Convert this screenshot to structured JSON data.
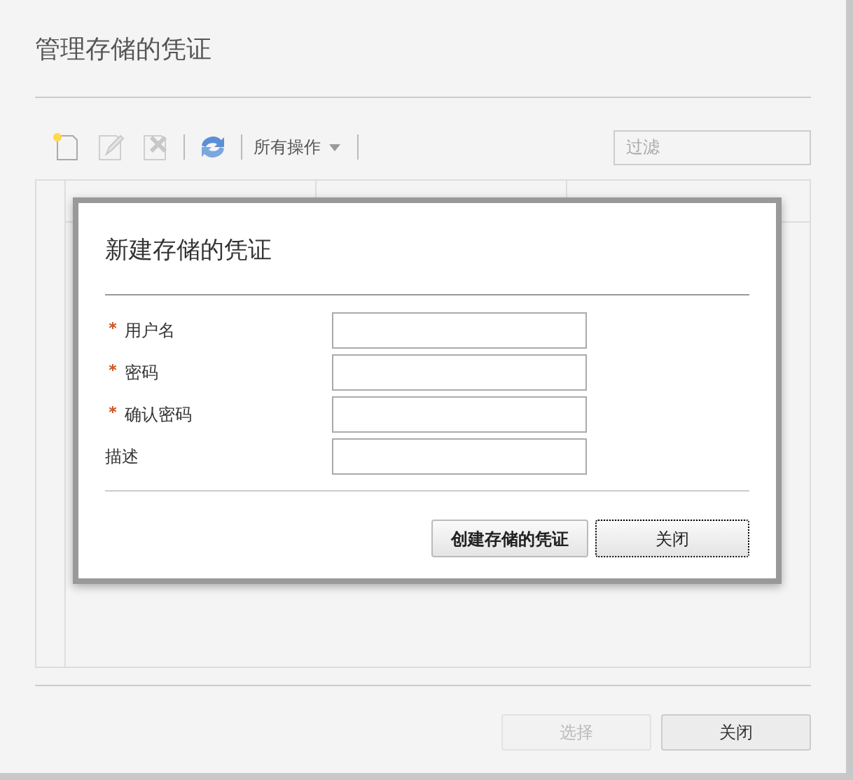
{
  "window": {
    "title": "管理存储的凭证"
  },
  "toolbar": {
    "buttons": [
      {
        "kind": "new",
        "disabled": false
      },
      {
        "kind": "edit",
        "disabled": true
      },
      {
        "kind": "delete",
        "disabled": true
      },
      {
        "kind": "refresh",
        "disabled": false
      }
    ],
    "menu": {
      "label": "所有操作"
    },
    "filter": {
      "placeholder": "过滤"
    }
  },
  "dialog": {
    "title": "新建存储的凭证",
    "fields": [
      {
        "label": "用户名",
        "required": true
      },
      {
        "label": "密码",
        "required": true
      },
      {
        "label": "确认密码",
        "required": true
      },
      {
        "label": "描述",
        "required": false
      }
    ],
    "buttons": [
      {
        "label": "创建存储的凭证",
        "focused": false
      },
      {
        "label": "关闭",
        "focused": true
      }
    ]
  },
  "buttons": [
    {
      "label": "选择",
      "disabled": true
    },
    {
      "label": "关闭",
      "disabled": false
    }
  ]
}
